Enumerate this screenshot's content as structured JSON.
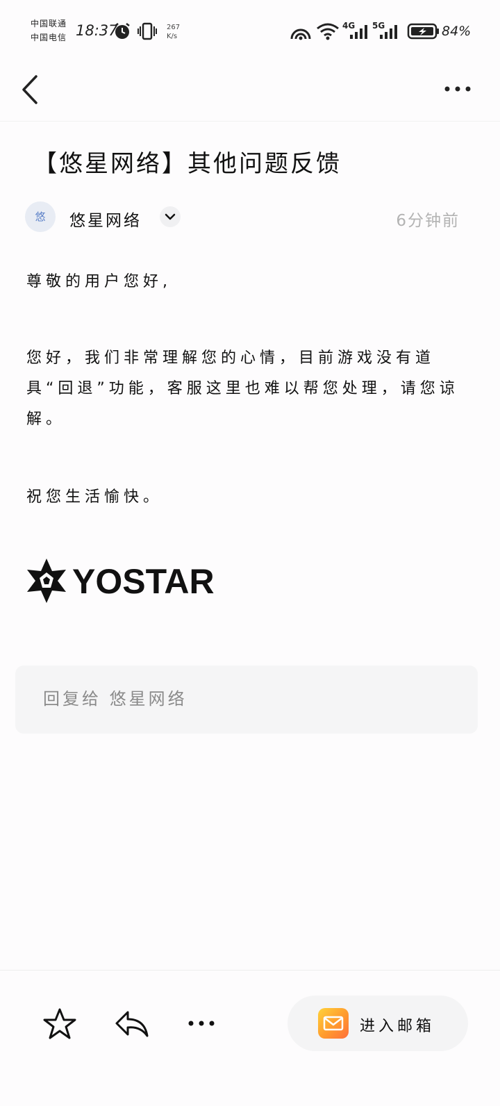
{
  "status_bar": {
    "carrier_1": "中国联通",
    "carrier_2": "中国电信",
    "time": "18:37",
    "speed_value": "267",
    "speed_unit": "K/s",
    "network_1": "4G",
    "network_2": "5G",
    "battery": "84%",
    "icons": [
      "alarm-icon",
      "vibrate-icon",
      "hotspot-icon",
      "wifi-icon",
      "signal-icon",
      "battery-charging-icon"
    ]
  },
  "nav": {
    "back_icon": "chevron-left-icon",
    "more_icon": "more-horizontal-icon"
  },
  "email": {
    "subject": "【悠星网络】其他问题反馈",
    "sender_avatar": "悠",
    "sender_name": "悠星网络",
    "time": "6分钟前",
    "greeting": "尊敬的用户您好,",
    "paragraph": "您好，我们非常理解您的心情，目前游戏没有道具“回退”功能，客服这里也难以帮您处理，请您谅解。",
    "closing": "祝您生活愉快。",
    "logo_text": "YOSTAR"
  },
  "reply": {
    "placeholder": "回复给 悠星网络"
  },
  "bottom_bar": {
    "star_icon": "star-icon",
    "reply_icon": "reply-icon",
    "more_icon": "more-horizontal-icon",
    "mailbox_label": "进入邮箱",
    "mailbox_icon": "mail-icon"
  },
  "colors": {
    "background": "#fdfcfd",
    "time_gray": "#b3b3b3",
    "reply_box": "#f5f5f6",
    "mail_icon_gradient": "#ff9a2e"
  }
}
